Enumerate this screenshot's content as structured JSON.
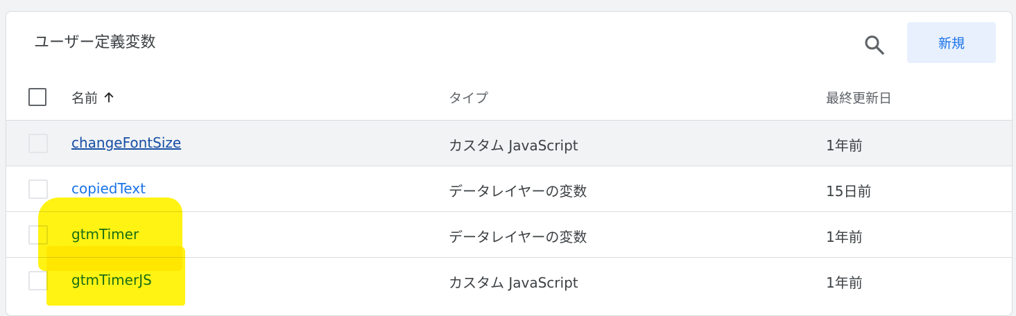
{
  "panel": {
    "title": "ユーザー定義変数",
    "search_icon": "search-icon",
    "new_button_label": "新規"
  },
  "table": {
    "columns": {
      "name": "名前",
      "name_sort_icon": "arrow-up-icon",
      "type": "タイプ",
      "last_edited": "最終更新日"
    },
    "rows": [
      {
        "name": "changeFontSize",
        "type": "カスタム JavaScript",
        "last_edited": "1年前"
      },
      {
        "name": "copiedText",
        "type": "データレイヤーの変数",
        "last_edited": "15日前"
      },
      {
        "name": "gtmTimer",
        "type": "データレイヤーの変数",
        "last_edited": "1年前"
      },
      {
        "name": "gtmTimerJS",
        "type": "カスタム JavaScript",
        "last_edited": "1年前"
      }
    ]
  },
  "colors": {
    "accent": "#1a73e8",
    "highlighter": "#fff200"
  }
}
